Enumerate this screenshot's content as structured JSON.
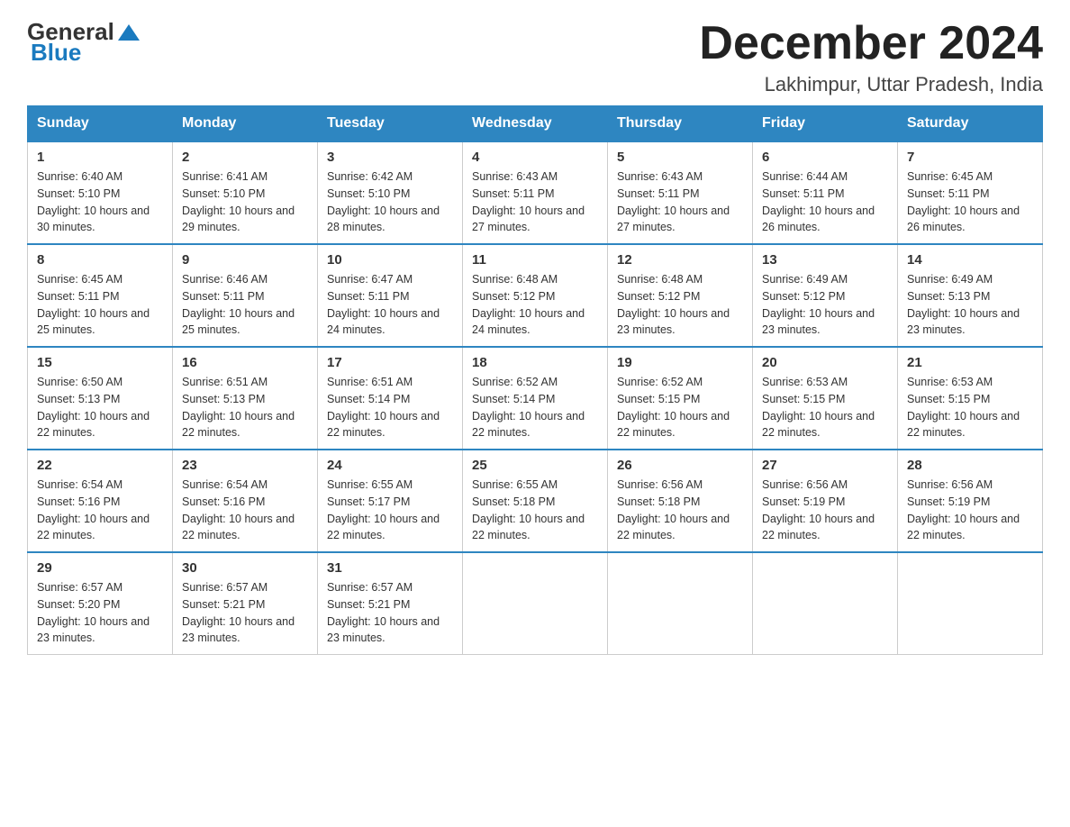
{
  "logo": {
    "general": "General",
    "blue": "Blue"
  },
  "header": {
    "month_year": "December 2024",
    "location": "Lakhimpur, Uttar Pradesh, India"
  },
  "weekdays": [
    "Sunday",
    "Monday",
    "Tuesday",
    "Wednesday",
    "Thursday",
    "Friday",
    "Saturday"
  ],
  "weeks": [
    [
      {
        "day": "1",
        "sunrise": "Sunrise: 6:40 AM",
        "sunset": "Sunset: 5:10 PM",
        "daylight": "Daylight: 10 hours and 30 minutes."
      },
      {
        "day": "2",
        "sunrise": "Sunrise: 6:41 AM",
        "sunset": "Sunset: 5:10 PM",
        "daylight": "Daylight: 10 hours and 29 minutes."
      },
      {
        "day": "3",
        "sunrise": "Sunrise: 6:42 AM",
        "sunset": "Sunset: 5:10 PM",
        "daylight": "Daylight: 10 hours and 28 minutes."
      },
      {
        "day": "4",
        "sunrise": "Sunrise: 6:43 AM",
        "sunset": "Sunset: 5:11 PM",
        "daylight": "Daylight: 10 hours and 27 minutes."
      },
      {
        "day": "5",
        "sunrise": "Sunrise: 6:43 AM",
        "sunset": "Sunset: 5:11 PM",
        "daylight": "Daylight: 10 hours and 27 minutes."
      },
      {
        "day": "6",
        "sunrise": "Sunrise: 6:44 AM",
        "sunset": "Sunset: 5:11 PM",
        "daylight": "Daylight: 10 hours and 26 minutes."
      },
      {
        "day": "7",
        "sunrise": "Sunrise: 6:45 AM",
        "sunset": "Sunset: 5:11 PM",
        "daylight": "Daylight: 10 hours and 26 minutes."
      }
    ],
    [
      {
        "day": "8",
        "sunrise": "Sunrise: 6:45 AM",
        "sunset": "Sunset: 5:11 PM",
        "daylight": "Daylight: 10 hours and 25 minutes."
      },
      {
        "day": "9",
        "sunrise": "Sunrise: 6:46 AM",
        "sunset": "Sunset: 5:11 PM",
        "daylight": "Daylight: 10 hours and 25 minutes."
      },
      {
        "day": "10",
        "sunrise": "Sunrise: 6:47 AM",
        "sunset": "Sunset: 5:11 PM",
        "daylight": "Daylight: 10 hours and 24 minutes."
      },
      {
        "day": "11",
        "sunrise": "Sunrise: 6:48 AM",
        "sunset": "Sunset: 5:12 PM",
        "daylight": "Daylight: 10 hours and 24 minutes."
      },
      {
        "day": "12",
        "sunrise": "Sunrise: 6:48 AM",
        "sunset": "Sunset: 5:12 PM",
        "daylight": "Daylight: 10 hours and 23 minutes."
      },
      {
        "day": "13",
        "sunrise": "Sunrise: 6:49 AM",
        "sunset": "Sunset: 5:12 PM",
        "daylight": "Daylight: 10 hours and 23 minutes."
      },
      {
        "day": "14",
        "sunrise": "Sunrise: 6:49 AM",
        "sunset": "Sunset: 5:13 PM",
        "daylight": "Daylight: 10 hours and 23 minutes."
      }
    ],
    [
      {
        "day": "15",
        "sunrise": "Sunrise: 6:50 AM",
        "sunset": "Sunset: 5:13 PM",
        "daylight": "Daylight: 10 hours and 22 minutes."
      },
      {
        "day": "16",
        "sunrise": "Sunrise: 6:51 AM",
        "sunset": "Sunset: 5:13 PM",
        "daylight": "Daylight: 10 hours and 22 minutes."
      },
      {
        "day": "17",
        "sunrise": "Sunrise: 6:51 AM",
        "sunset": "Sunset: 5:14 PM",
        "daylight": "Daylight: 10 hours and 22 minutes."
      },
      {
        "day": "18",
        "sunrise": "Sunrise: 6:52 AM",
        "sunset": "Sunset: 5:14 PM",
        "daylight": "Daylight: 10 hours and 22 minutes."
      },
      {
        "day": "19",
        "sunrise": "Sunrise: 6:52 AM",
        "sunset": "Sunset: 5:15 PM",
        "daylight": "Daylight: 10 hours and 22 minutes."
      },
      {
        "day": "20",
        "sunrise": "Sunrise: 6:53 AM",
        "sunset": "Sunset: 5:15 PM",
        "daylight": "Daylight: 10 hours and 22 minutes."
      },
      {
        "day": "21",
        "sunrise": "Sunrise: 6:53 AM",
        "sunset": "Sunset: 5:15 PM",
        "daylight": "Daylight: 10 hours and 22 minutes."
      }
    ],
    [
      {
        "day": "22",
        "sunrise": "Sunrise: 6:54 AM",
        "sunset": "Sunset: 5:16 PM",
        "daylight": "Daylight: 10 hours and 22 minutes."
      },
      {
        "day": "23",
        "sunrise": "Sunrise: 6:54 AM",
        "sunset": "Sunset: 5:16 PM",
        "daylight": "Daylight: 10 hours and 22 minutes."
      },
      {
        "day": "24",
        "sunrise": "Sunrise: 6:55 AM",
        "sunset": "Sunset: 5:17 PM",
        "daylight": "Daylight: 10 hours and 22 minutes."
      },
      {
        "day": "25",
        "sunrise": "Sunrise: 6:55 AM",
        "sunset": "Sunset: 5:18 PM",
        "daylight": "Daylight: 10 hours and 22 minutes."
      },
      {
        "day": "26",
        "sunrise": "Sunrise: 6:56 AM",
        "sunset": "Sunset: 5:18 PM",
        "daylight": "Daylight: 10 hours and 22 minutes."
      },
      {
        "day": "27",
        "sunrise": "Sunrise: 6:56 AM",
        "sunset": "Sunset: 5:19 PM",
        "daylight": "Daylight: 10 hours and 22 minutes."
      },
      {
        "day": "28",
        "sunrise": "Sunrise: 6:56 AM",
        "sunset": "Sunset: 5:19 PM",
        "daylight": "Daylight: 10 hours and 22 minutes."
      }
    ],
    [
      {
        "day": "29",
        "sunrise": "Sunrise: 6:57 AM",
        "sunset": "Sunset: 5:20 PM",
        "daylight": "Daylight: 10 hours and 23 minutes."
      },
      {
        "day": "30",
        "sunrise": "Sunrise: 6:57 AM",
        "sunset": "Sunset: 5:21 PM",
        "daylight": "Daylight: 10 hours and 23 minutes."
      },
      {
        "day": "31",
        "sunrise": "Sunrise: 6:57 AM",
        "sunset": "Sunset: 5:21 PM",
        "daylight": "Daylight: 10 hours and 23 minutes."
      },
      null,
      null,
      null,
      null
    ]
  ]
}
